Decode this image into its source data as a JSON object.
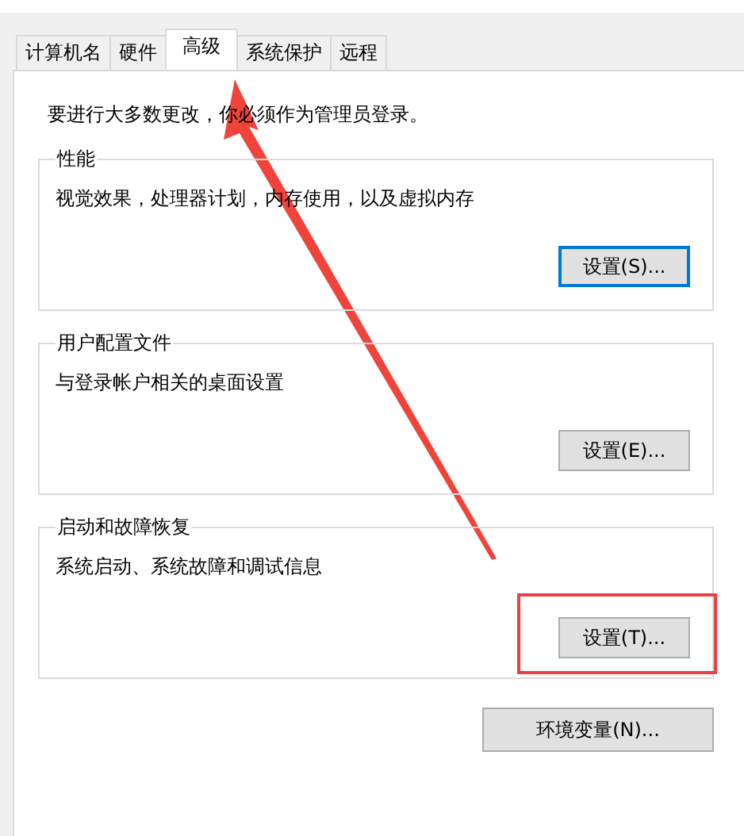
{
  "tabs": [
    {
      "label": "计算机名",
      "selected": false
    },
    {
      "label": "硬件",
      "selected": false
    },
    {
      "label": "高级",
      "selected": true
    },
    {
      "label": "系统保护",
      "selected": false
    },
    {
      "label": "远程",
      "selected": false
    }
  ],
  "intro": "要进行大多数更改，你必须作为管理员登录。",
  "groups": [
    {
      "title": "性能",
      "description": "视觉效果，处理器计划，内存使用，以及虚拟内存",
      "button": {
        "label": "设置(S)...",
        "default": true,
        "highlighted": false
      }
    },
    {
      "title": "用户配置文件",
      "description": "与登录帐户相关的桌面设置",
      "button": {
        "label": "设置(E)...",
        "default": false,
        "highlighted": false
      }
    },
    {
      "title": "启动和故障恢复",
      "description": "系统启动、系统故障和调试信息",
      "button": {
        "label": "设置(T)...",
        "default": false,
        "highlighted": true
      }
    }
  ],
  "env_button": "环境变量(N)..."
}
